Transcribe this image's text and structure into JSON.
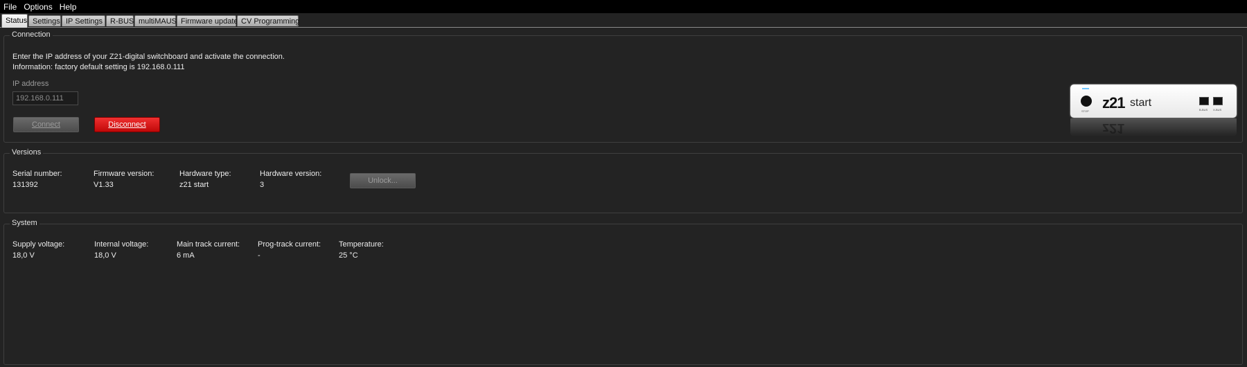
{
  "menu": {
    "items": [
      "File",
      "Options",
      "Help"
    ]
  },
  "tabs": [
    "Status",
    "Settings",
    "IP Settings",
    "R-BUS",
    "multiMAUS",
    "Firmware update",
    "CV Programming"
  ],
  "active_tab": "Status",
  "connection": {
    "title": "Connection",
    "info_line1": "Enter the IP address of your Z21-digital switchboard and activate the connection.",
    "info_line2": "Information: factory default setting is 192.168.0.111",
    "ip_label": "IP address",
    "ip_value": "192.168.0.111",
    "connect_label": "Connect",
    "disconnect_label": "Disconnect",
    "device": {
      "logo": "z21",
      "logo_sub": "start",
      "knob_label": "STOP",
      "port1_label": "B-BUS",
      "port2_label": "X-BUS"
    }
  },
  "versions": {
    "title": "Versions",
    "fields": [
      {
        "label": "Serial number:",
        "value": "131392"
      },
      {
        "label": "Firmware version:",
        "value": "V1.33"
      },
      {
        "label": "Hardware type:",
        "value": "z21 start"
      },
      {
        "label": "Hardware version:",
        "value": "3"
      }
    ],
    "unlock_label": "Unlock..."
  },
  "system": {
    "title": "System",
    "fields": [
      {
        "label": "Supply voltage:",
        "value": "18,0 V"
      },
      {
        "label": "Internal voltage:",
        "value": "18,0 V"
      },
      {
        "label": "Main track current:",
        "value": "6 mA"
      },
      {
        "label": "Prog-track current:",
        "value": "-"
      },
      {
        "label": "Temperature:",
        "value": "25 °C"
      }
    ]
  },
  "colors": {
    "background": "#232323",
    "menubar": "#000000",
    "disconnect": "#d81818",
    "device_led": "#6fc6ff"
  }
}
